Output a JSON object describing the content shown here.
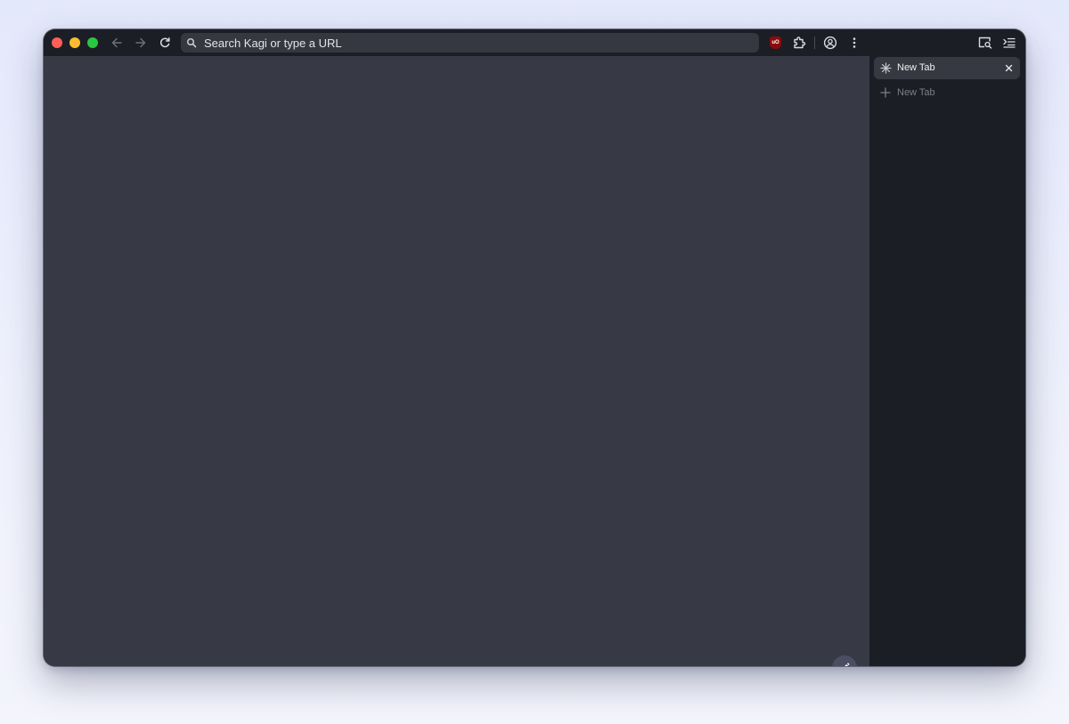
{
  "window": {
    "traffic_lights": [
      "close",
      "minimize",
      "zoom"
    ]
  },
  "toolbar": {
    "back_icon": "arrow-left-icon",
    "forward_icon": "arrow-right-icon",
    "reload_icon": "reload-icon",
    "address_placeholder": "Search Kagi or type a URL",
    "address_value": "",
    "extensions": [
      {
        "name": "ublock-origin",
        "label": "uO",
        "color": "#8e0a0a"
      }
    ],
    "extensions_icon": "puzzle-icon",
    "profile_icon": "account-circle-icon",
    "menu_icon": "kebab-menu-icon",
    "right_icons": [
      "tab-search-icon",
      "sidebar-toggle-icon"
    ]
  },
  "sidebar": {
    "tabs": [
      {
        "title": "New Tab",
        "active": true,
        "favicon": "asterisk-icon"
      }
    ],
    "new_tab_label": "New Tab"
  },
  "content": {
    "edit_button_icon": "pencil-icon"
  },
  "colors": {
    "content_bg": "#373a44",
    "chrome_bg": "#1c1e25",
    "address_bg": "#353841",
    "active_tab_bg": "#363941",
    "close": "#fe5f57",
    "minimize": "#febc2e",
    "zoom": "#28c840"
  }
}
